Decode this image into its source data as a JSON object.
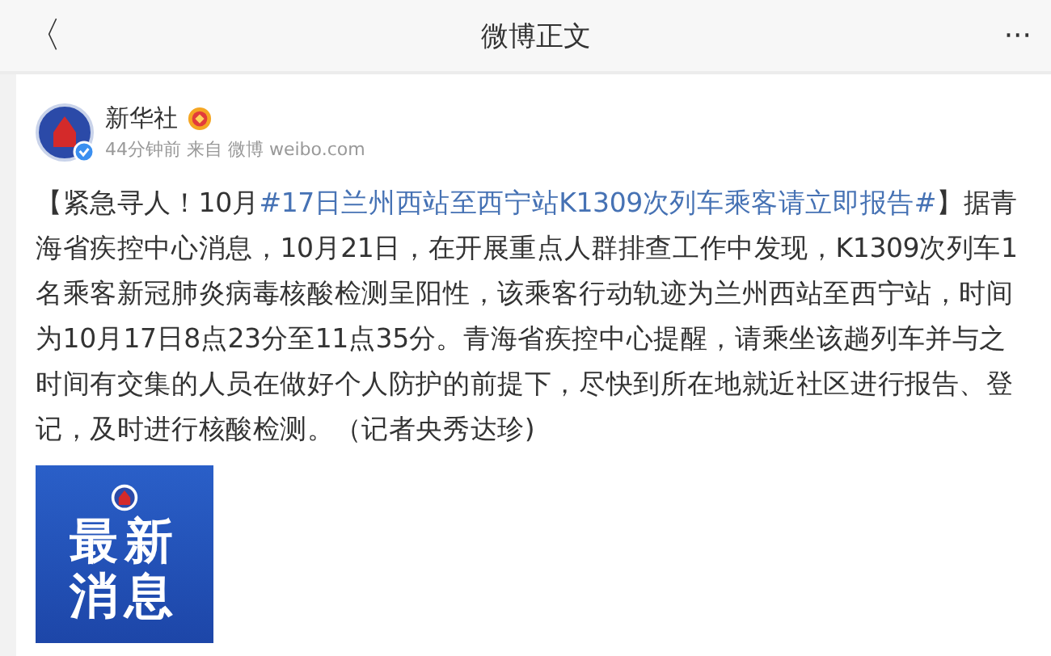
{
  "header": {
    "back": "〈",
    "title": "微博正文",
    "more": "···"
  },
  "post": {
    "author": "新华社",
    "meta": "44分钟前 来自 微博 weibo.com",
    "segments": [
      {
        "kind": "plain",
        "text": "【紧急寻人！10月"
      },
      {
        "kind": "topic",
        "text": "#17日兰州西站至西宁站K1309次列车乘客请立即报告#"
      },
      {
        "kind": "plain",
        "text": "】据青海省疾控中心消息，10月21日，在开展重点人群排查工作中发现，K1309次列车1名乘客新冠肺炎病毒核酸检测呈阳性，该乘客行动轨迹为兰州西站至西宁站，时间为10月17日8点23分至11点35分。青海省疾控中心提醒，请乘坐该趟列车并与之时间有交集的人员在做好个人防护的前提下，尽快到所在地就近社区进行报告、登记，及时进行核酸检测。（记者央秀达珍)"
      }
    ],
    "image": {
      "lines": [
        "最新",
        "消息"
      ]
    }
  }
}
